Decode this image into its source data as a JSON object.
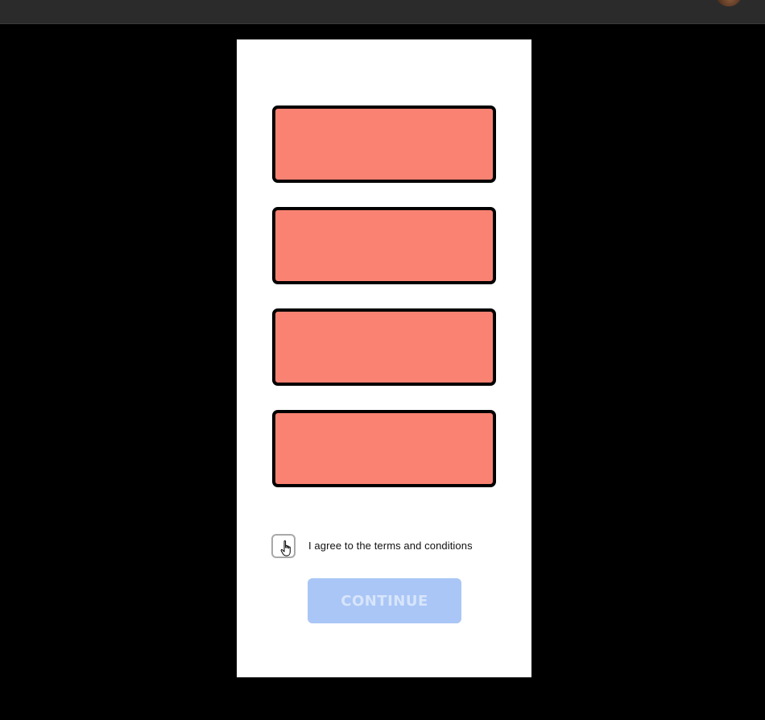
{
  "topbar": {
    "avatar_icon": "user-avatar"
  },
  "form": {
    "blocks": [
      {
        "color": "#fa8272"
      },
      {
        "color": "#fa8272"
      },
      {
        "color": "#fa8272"
      },
      {
        "color": "#fa8272"
      }
    ],
    "terms_label": "I agree to the terms and conditions",
    "terms_checked": false,
    "continue_label": "CONTINUE",
    "continue_enabled": false,
    "continue_color": "#aac6f6",
    "pointer_icon": "hand-pointer-icon"
  }
}
